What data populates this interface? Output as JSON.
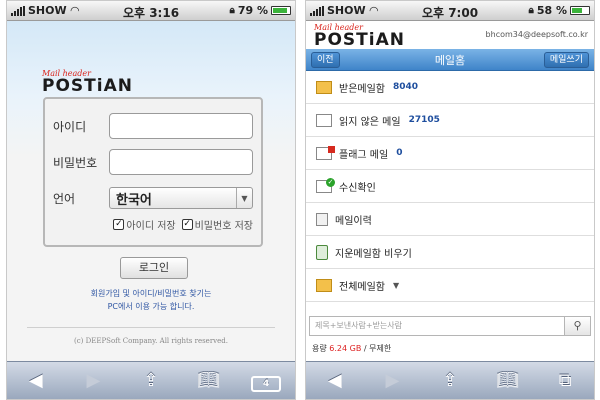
{
  "left": {
    "status": {
      "carrier": "SHOW",
      "time": "오후 3:16",
      "battery": "79 %"
    },
    "logo": {
      "tagline": "Mail header",
      "name": "POSTiAN"
    },
    "form": {
      "id_label": "아이디",
      "password_label": "비밀번호",
      "language_label": "언어",
      "language_value": "한국어",
      "save_id": "아이디 저장",
      "save_password": "비밀번호 저장",
      "login_button": "로그인"
    },
    "join_line1": "회원가입 및 아이디/비밀번호 찾기는",
    "join_line2": "PC에서 이용 가능 합니다.",
    "copyright": "(c) DEEPSoft Company.  All rights reserved.",
    "toolbar": {
      "tabs_count": "4"
    }
  },
  "right": {
    "status": {
      "carrier": "SHOW",
      "time": "오후 7:00",
      "battery": "58 %"
    },
    "logo": {
      "tagline": "Mail header",
      "name": "POSTiAN"
    },
    "user_email": "bhcom34@deepsoft.co.kr",
    "nav": {
      "back": "이전",
      "title": "메일홈",
      "compose": "메일쓰기"
    },
    "menu": [
      {
        "label": "받은메일함",
        "count": "8040"
      },
      {
        "label": "읽지 않은 메일",
        "count": "27105"
      },
      {
        "label": "플래그 메일",
        "count": "0"
      },
      {
        "label": "수신확인",
        "count": ""
      },
      {
        "label": "메일이력",
        "count": ""
      },
      {
        "label": "지운메일함 비우기",
        "count": ""
      },
      {
        "label": "전체메일함",
        "count": ""
      }
    ],
    "search": {
      "placeholder": "제목+보낸사람+받는사람"
    },
    "quota": {
      "label": "용량",
      "used": "6.24 GB",
      "total": "/ 무제한"
    }
  },
  "icons": [
    "wifi-icon",
    "lock-icon",
    "back-arrow-icon",
    "forward-arrow-icon",
    "share-icon",
    "bookmarks-icon",
    "tabs-icon",
    "search-icon",
    "envelope-icon",
    "flag-icon",
    "check-icon",
    "history-icon",
    "trash-icon"
  ],
  "colors": {
    "accent": "#3f84c9",
    "count": "#1e4e9e",
    "quota": "#dd2222",
    "logo_tag": "#d9241c"
  }
}
